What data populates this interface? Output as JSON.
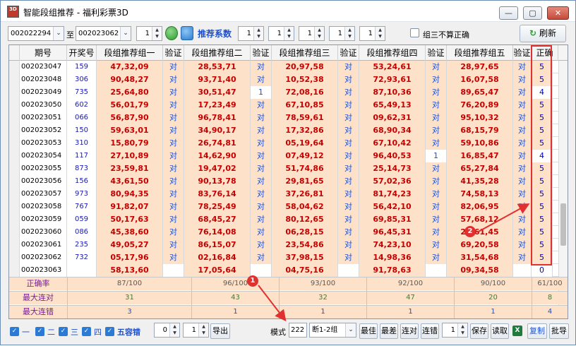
{
  "window": {
    "title": "智能段组推荐 - 福利彩票3D",
    "app_icon_text": "3D"
  },
  "toolbar": {
    "period_from": "002022294",
    "to_label": "至",
    "period_to": "002023062",
    "step_value": "1",
    "recommend_coef_label": "推荐系数",
    "coef_values": [
      "1",
      "1",
      "1",
      "1",
      "1"
    ],
    "no_triplet_label": "组三不算正确",
    "refresh_label": "刷新"
  },
  "table": {
    "headers": [
      "期号",
      "开奖号",
      "段组推荐组一",
      "验证",
      "段组推荐组二",
      "验证",
      "段组推荐组三",
      "验证",
      "段组推荐组四",
      "验证",
      "段组推荐组五",
      "验证",
      "正确"
    ],
    "rows": [
      {
        "period": "002023047",
        "prize": "159",
        "g1": "47,32,09",
        "v1": "对",
        "g2": "28,53,71",
        "v2": "对",
        "g3": "20,97,58",
        "v3": "对",
        "g4": "53,24,61",
        "v4": "对",
        "g5": "28,97,65",
        "v5": "对",
        "correct": "5"
      },
      {
        "period": "002023048",
        "prize": "306",
        "g1": "90,48,27",
        "v1": "对",
        "g2": "93,71,40",
        "v2": "对",
        "g3": "10,52,38",
        "v3": "对",
        "g4": "72,93,61",
        "v4": "对",
        "g5": "16,07,58",
        "v5": "对",
        "correct": "5"
      },
      {
        "period": "002023049",
        "prize": "735",
        "g1": "25,64,80",
        "v1": "对",
        "g2": "30,51,47",
        "v2": "1",
        "g3": "72,08,16",
        "v3": "对",
        "g4": "87,10,36",
        "v4": "对",
        "g5": "89,65,47",
        "v5": "对",
        "correct": "4"
      },
      {
        "period": "002023050",
        "prize": "602",
        "g1": "56,01,79",
        "v1": "对",
        "g2": "17,23,49",
        "v2": "对",
        "g3": "67,10,85",
        "v3": "对",
        "g4": "65,49,13",
        "v4": "对",
        "g5": "76,20,89",
        "v5": "对",
        "correct": "5"
      },
      {
        "period": "002023051",
        "prize": "066",
        "g1": "56,87,90",
        "v1": "对",
        "g2": "96,78,41",
        "v2": "对",
        "g3": "78,59,61",
        "v3": "对",
        "g4": "09,62,31",
        "v4": "对",
        "g5": "95,10,32",
        "v5": "对",
        "correct": "5"
      },
      {
        "period": "002023052",
        "prize": "150",
        "g1": "59,63,01",
        "v1": "对",
        "g2": "34,90,17",
        "v2": "对",
        "g3": "17,32,86",
        "v3": "对",
        "g4": "68,90,34",
        "v4": "对",
        "g5": "68,15,79",
        "v5": "对",
        "correct": "5"
      },
      {
        "period": "002023053",
        "prize": "310",
        "g1": "15,80,79",
        "v1": "对",
        "g2": "26,74,81",
        "v2": "对",
        "g3": "05,19,64",
        "v3": "对",
        "g4": "67,10,42",
        "v4": "对",
        "g5": "59,10,86",
        "v5": "对",
        "correct": "5"
      },
      {
        "period": "002023054",
        "prize": "117",
        "g1": "27,10,89",
        "v1": "对",
        "g2": "14,62,90",
        "v2": "对",
        "g3": "07,49,12",
        "v3": "对",
        "g4": "96,40,53",
        "v4": "1",
        "g5": "16,85,47",
        "v5": "对",
        "correct": "4"
      },
      {
        "period": "002023055",
        "prize": "873",
        "g1": "23,59,81",
        "v1": "对",
        "g2": "19,47,02",
        "v2": "对",
        "g3": "51,74,86",
        "v3": "对",
        "g4": "25,14,73",
        "v4": "对",
        "g5": "65,27,84",
        "v5": "对",
        "correct": "5"
      },
      {
        "period": "002023056",
        "prize": "156",
        "g1": "43,61,50",
        "v1": "对",
        "g2": "90,13,78",
        "v2": "对",
        "g3": "29,81,65",
        "v3": "对",
        "g4": "57,02,36",
        "v4": "对",
        "g5": "41,35,28",
        "v5": "对",
        "correct": "5"
      },
      {
        "period": "002023057",
        "prize": "973",
        "g1": "80,94,35",
        "v1": "对",
        "g2": "83,76,14",
        "v2": "对",
        "g3": "37,26,81",
        "v3": "对",
        "g4": "81,74,23",
        "v4": "对",
        "g5": "74,58,13",
        "v5": "对",
        "correct": "5"
      },
      {
        "period": "002023058",
        "prize": "767",
        "g1": "91,82,07",
        "v1": "对",
        "g2": "78,25,49",
        "v2": "对",
        "g3": "58,04,62",
        "v3": "对",
        "g4": "56,42,10",
        "v4": "对",
        "g5": "82,06,95",
        "v5": "对",
        "correct": "5"
      },
      {
        "period": "002023059",
        "prize": "059",
        "g1": "50,17,63",
        "v1": "对",
        "g2": "68,45,27",
        "v2": "对",
        "g3": "80,12,65",
        "v3": "对",
        "g4": "69,85,31",
        "v4": "对",
        "g5": "57,68,12",
        "v5": "对",
        "correct": "5"
      },
      {
        "period": "002023060",
        "prize": "086",
        "g1": "45,38,60",
        "v1": "对",
        "g2": "76,14,08",
        "v2": "对",
        "g3": "06,28,15",
        "v3": "对",
        "g4": "96,45,31",
        "v4": "对",
        "g5": "28,61,45",
        "v5": "对",
        "correct": "5"
      },
      {
        "period": "002023061",
        "prize": "235",
        "g1": "49,05,27",
        "v1": "对",
        "g2": "86,15,07",
        "v2": "对",
        "g3": "23,54,86",
        "v3": "对",
        "g4": "74,23,10",
        "v4": "对",
        "g5": "69,20,58",
        "v5": "对",
        "correct": "5"
      },
      {
        "period": "002023062",
        "prize": "732",
        "g1": "05,17,96",
        "v1": "对",
        "g2": "02,16,84",
        "v2": "对",
        "g3": "37,98,15",
        "v3": "对",
        "g4": "14,98,36",
        "v4": "对",
        "g5": "31,54,68",
        "v5": "对",
        "correct": "5"
      },
      {
        "period": "002023063",
        "prize": "",
        "g1": "58,13,60",
        "v1": "",
        "g2": "17,05,64",
        "v2": "",
        "g3": "04,75,16",
        "v3": "",
        "g4": "91,78,63",
        "v4": "",
        "g5": "09,34,58",
        "v5": "",
        "correct": "0"
      }
    ],
    "stats": [
      {
        "label": "正确率",
        "values": [
          "87/100",
          "96/100",
          "93/100",
          "92/100",
          "90/100",
          "61/100"
        ]
      },
      {
        "label": "最大连对",
        "values": [
          "31",
          "43",
          "32",
          "47",
          "20",
          "8"
        ]
      },
      {
        "label": "最大连错",
        "values": [
          "3",
          "1",
          "1",
          "1",
          "1",
          "4"
        ]
      }
    ]
  },
  "bottom": {
    "checks": [
      "一",
      "二",
      "三",
      "四"
    ],
    "tolerance_label": "五容错",
    "spin_a": "0",
    "spin_b": "1",
    "export_label": "导出",
    "mode_label": "模式",
    "mode_value": "222",
    "break_value": "断1-2组",
    "buttons": [
      "最佳",
      "最差",
      "连对",
      "连错"
    ],
    "spin_c": "1",
    "save_label": "保存",
    "read_label": "读取",
    "copy_label": "复制",
    "batch_label": "批导"
  },
  "annotations": [
    "1",
    "2"
  ],
  "colors": {
    "group_text": "#c80000",
    "verify_text": "#1e50c8",
    "row_fill": "#fde1c8",
    "highlight": "#e03030",
    "stat_label": "#7a1ca0"
  }
}
